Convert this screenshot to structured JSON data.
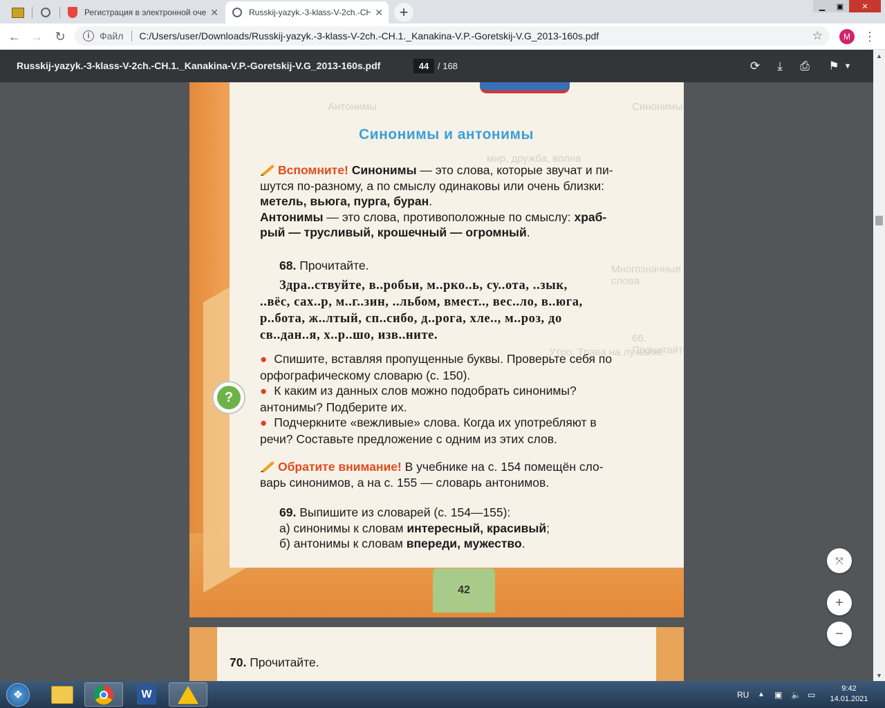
{
  "browser": {
    "tabs": [
      {
        "label": "",
        "icon": "book-icon"
      },
      {
        "label": "",
        "icon": "globe-icon"
      },
      {
        "label": "Регистрация в электронной оче",
        "icon": "shield-icon"
      },
      {
        "label": "Russkij-yazyk.-3-klass-V-2ch.-CH",
        "icon": "globe-icon"
      }
    ],
    "address": {
      "scheme": "Файл",
      "url": "C:/Users/user/Downloads/Russkij-yazyk.-3-klass-V-2ch.-CH.1._Kanakina-V.P.-Goretskij-V.G_2013-160s.pdf"
    },
    "profile_initial": "M"
  },
  "pdf": {
    "title": "Russkij-yazyk.-3-klass-V-2ch.-CH.1._Kanakina-V.P.-Goretskij-V.G_2013-160s.pdf",
    "current_page": "44",
    "total_pages": "/ 168"
  },
  "page": {
    "heading": "Синонимы и антонимы",
    "remember_label": "Вспомните!",
    "remember_line1_term": "Синонимы",
    "remember_line1_rest": " — это слова, которые звучат и пи-",
    "remember_line2": "шутся по-разному, а по смыслу одинаковы или очень близки:",
    "remember_line3": "метель, вьюга, пурга, буран",
    "remember_line4_term": "Антонимы",
    "remember_line4_rest": " — это слова, противоположные по смыслу: ",
    "remember_line4_bold": "храб-",
    "remember_line5": "рый — трусливый, крошечный — огромный",
    "ex68_num": "68.",
    "ex68_task": "Прочитайте.",
    "words": [
      "Здра..ствуйте, в..робьи, м..рко..ь, су..ота, ..зык,",
      "..вёс, сах..р, м..г..зин, ..льбом, вмест.., вес..ло, в..юга,",
      "р..бота, ж..лтый, сп..сибо, д..рога, хле.., м..роз, до",
      "св..дан..я, х..р..шо, изв..ните."
    ],
    "bullets": [
      [
        "Спишите, вставляя пропущенные буквы. Проверьте себя по",
        "орфографическому словарю (с. 150)."
      ],
      [
        "К каким из данных слов можно подобрать синонимы?",
        "антонимы? Подберите их."
      ],
      [
        "Подчеркните «вежливые» слова. Когда их употребляют в",
        "речи? Составьте предложение с одним из этих слов."
      ]
    ],
    "attention_label": "Обратите внимание!",
    "attention_line1": " В учебнике на с. 154 помещён сло-",
    "attention_line2": "варь синонимов, а на с. 155 — словарь антонимов.",
    "ex69_num": "69.",
    "ex69_task": "Выпишите из словарей (с. 154—155):",
    "ex69_a_prefix": "а) синонимы к словам ",
    "ex69_a_bold": "интересный, красивый",
    "ex69_b_prefix": "б) антонимы к словам ",
    "ex69_b_bold": "впереди, мужество",
    "question_mark": "?",
    "page_number": "42",
    "next_page_num": "70.",
    "next_page_task": "Прочитайте."
  },
  "taskbar": {
    "lang": "RU",
    "time": "9:42",
    "date": "14.01.2021"
  }
}
